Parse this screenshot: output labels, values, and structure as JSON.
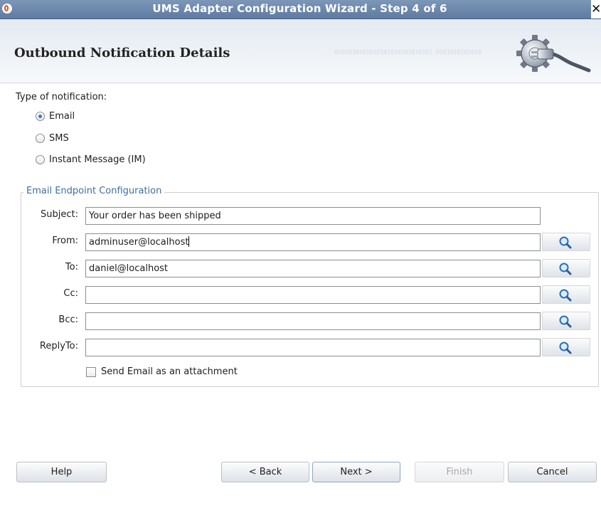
{
  "window": {
    "title": "UMS Adapter Configuration Wizard - Step 4 of 6",
    "close_glyph": "✕"
  },
  "header": {
    "title": "Outbound Notification Details",
    "binary_pattern": "0101010101010101010101010101 0101010101010"
  },
  "notification_type": {
    "label": "Type of notification:",
    "options": [
      {
        "label": "Email",
        "selected": true
      },
      {
        "label": "SMS",
        "selected": false
      },
      {
        "label": "Instant Message (IM)",
        "selected": false
      }
    ]
  },
  "email_config": {
    "legend": "Email Endpoint Configuration",
    "fields": [
      {
        "label": "Subject:",
        "value": "Your order has been shipped",
        "has_lookup": false
      },
      {
        "label": "From:",
        "value": "adminuser@localhost",
        "has_lookup": true
      },
      {
        "label": "To:",
        "value": "daniel@localhost",
        "has_lookup": true
      },
      {
        "label": "Cc:",
        "value": "",
        "has_lookup": true
      },
      {
        "label": "Bcc:",
        "value": "",
        "has_lookup": true
      },
      {
        "label": "ReplyTo:",
        "value": "",
        "has_lookup": true
      }
    ],
    "attachment_checkbox": {
      "label": "Send Email as an attachment",
      "checked": false
    }
  },
  "footer": {
    "help": "Help",
    "back": "< Back",
    "next": "Next >",
    "finish": "Finish",
    "cancel": "Cancel"
  },
  "icons": {
    "lookup": "search-icon",
    "header": "gear-icon",
    "app": "oracle-app-icon"
  },
  "colors": {
    "titlebar": "#6e89ad",
    "legend": "#3f6fa0",
    "radio_selected": "#3a74c9"
  }
}
